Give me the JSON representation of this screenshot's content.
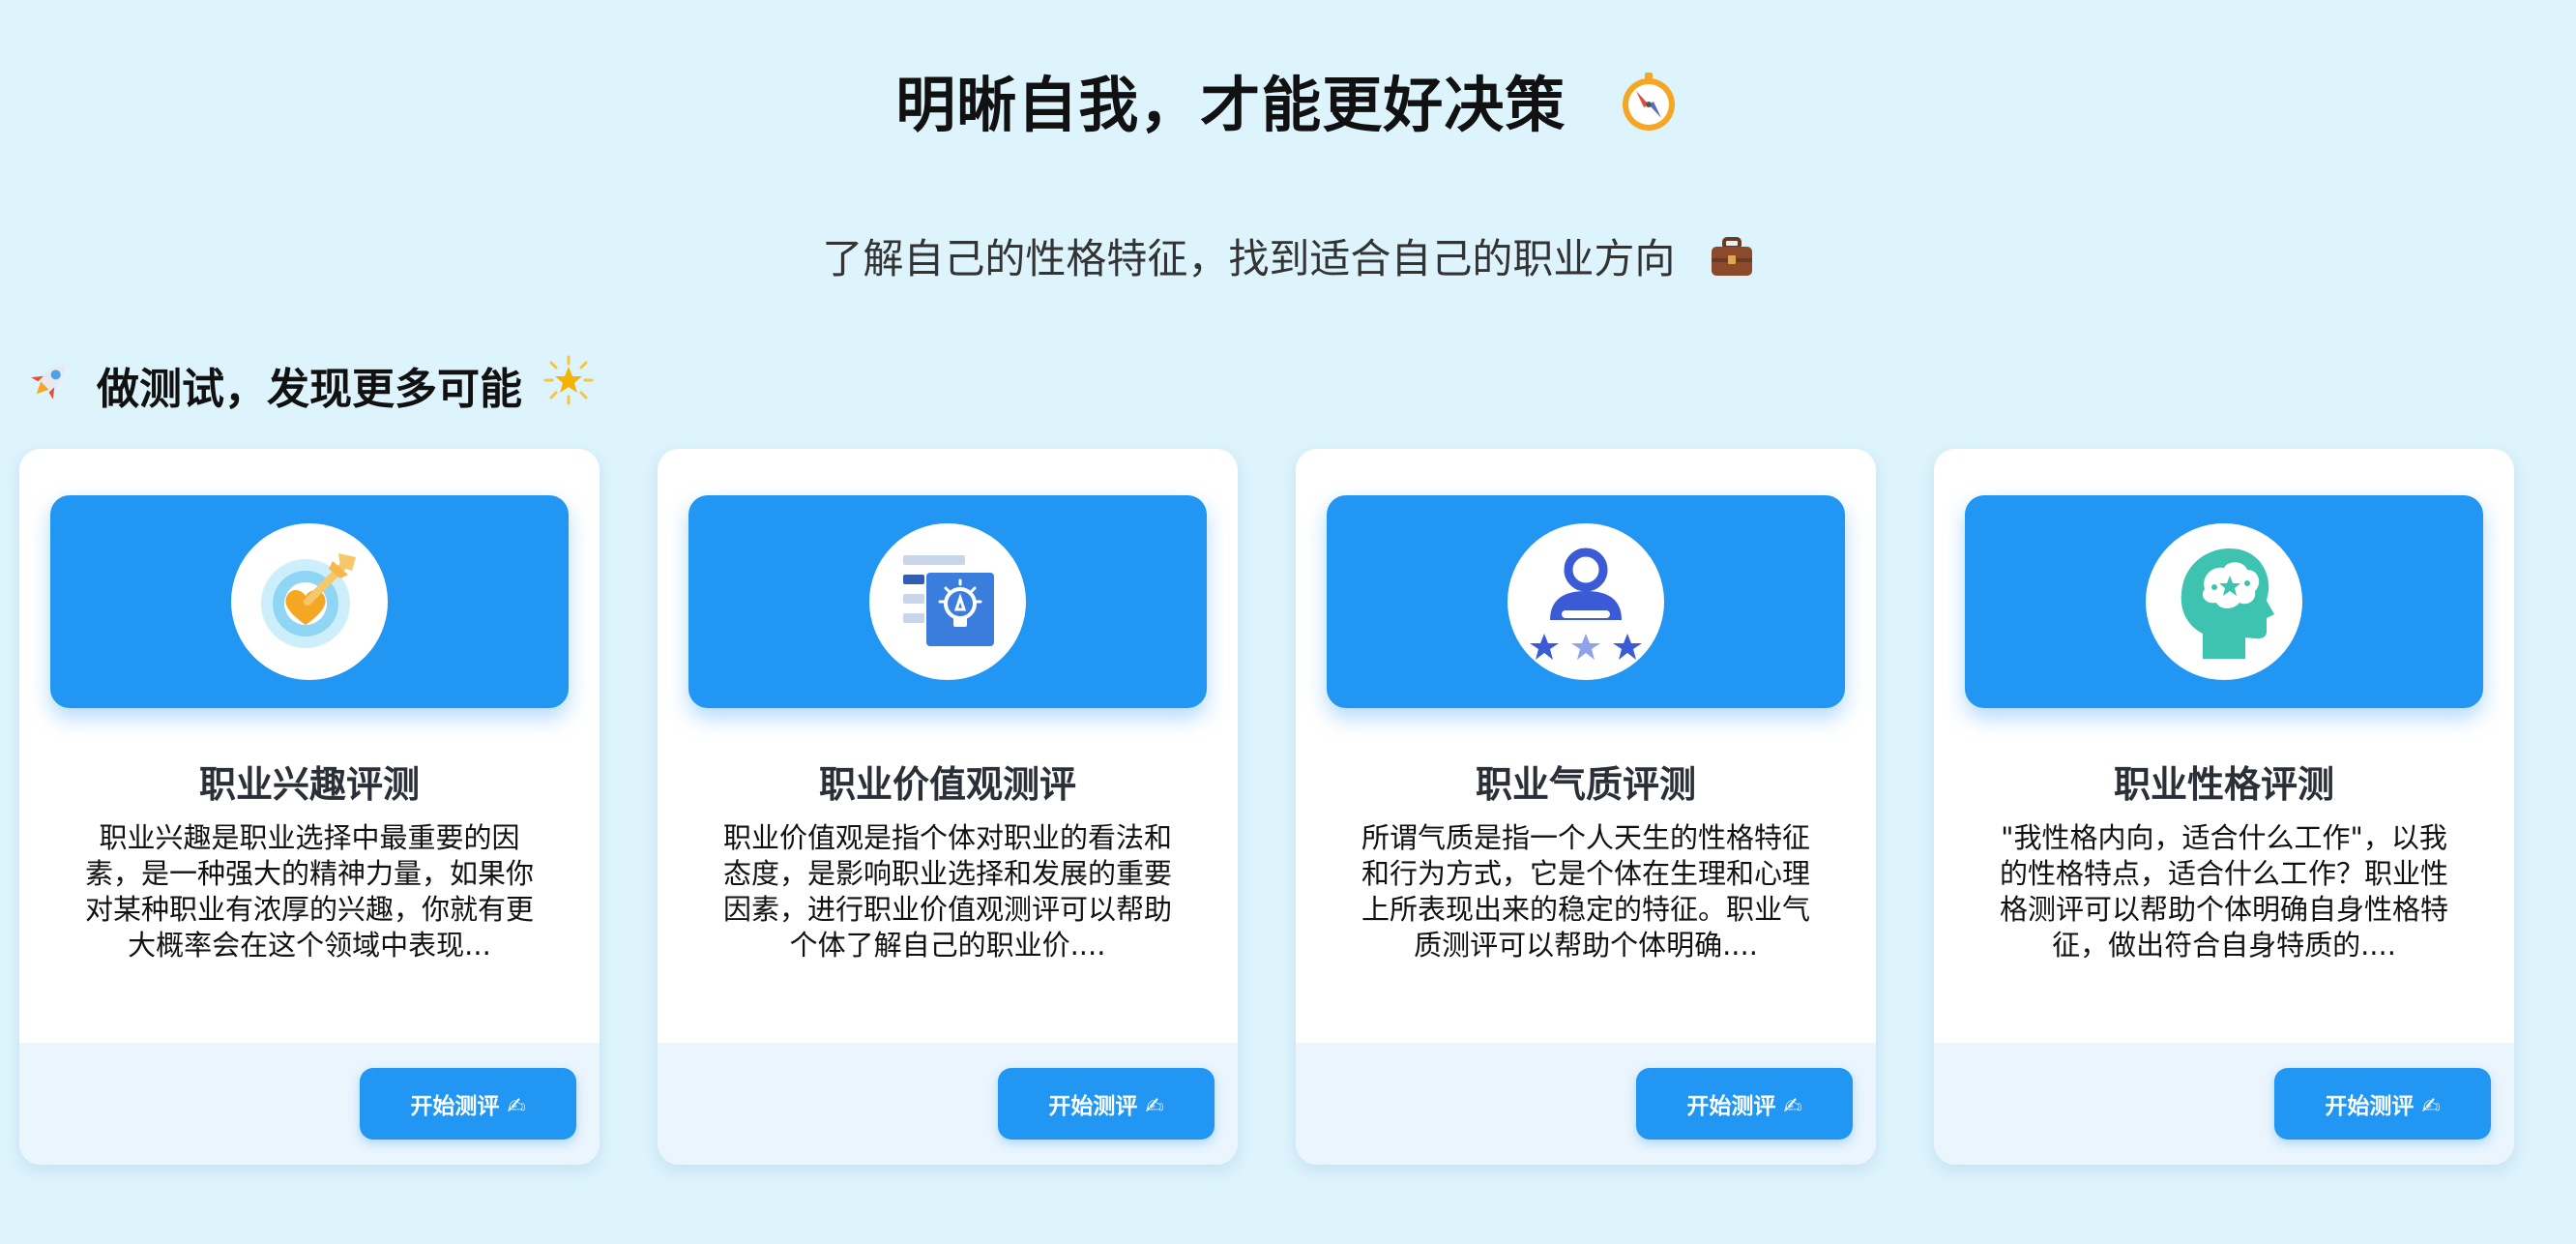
{
  "hero": {
    "title": "明晰自我，才能更好决策",
    "title_icon": "compass-icon",
    "subtitle": "了解自己的性格特征，找到适合自己的职业方向",
    "subtitle_icon": "briefcase-icon"
  },
  "section": {
    "title": "做测试，发现更多可能",
    "leading_icon": "rocket-icon",
    "trailing_icon": "glowing-star-icon"
  },
  "cards": [
    {
      "icon": "target-heart-icon",
      "title": "职业兴趣评测",
      "description": "职业兴趣是职业选择中最重要的因素，是一种强大的精神力量，如果你对某种职业有浓厚的兴趣，你就有更大概率会在这个领域中表现...",
      "button_label": "开始测评 ✍"
    },
    {
      "icon": "lightbulb-list-icon",
      "title": "职业价值观测评",
      "description": "职业价值观是指个体对职业的看法和态度，是影响职业选择和发展的重要因素，进行职业价值观测评可以帮助个体了解自己的职业价....",
      "button_label": "开始测评 ✍"
    },
    {
      "icon": "person-stars-icon",
      "title": "职业气质评测",
      "description": "所谓气质是指一个人天生的性格特征和行为方式，它是个体在生理和心理上所表现出来的稳定的特征。职业气质测评可以帮助个体明确....",
      "button_label": "开始测评 ✍"
    },
    {
      "icon": "head-brain-icon",
      "title": "职业性格评测",
      "description": "\"我性格内向，适合什么工作\"，以我的性格特点，适合什么工作？职业性格测评可以帮助个体明确自身性格特征，做出符合自身特质的....",
      "button_label": "开始测评 ✍"
    }
  ],
  "colors": {
    "page_background": "#def4fd",
    "accent": "#2196f3",
    "card_background": "#ffffff",
    "card_footer": "#eaf5fd"
  }
}
